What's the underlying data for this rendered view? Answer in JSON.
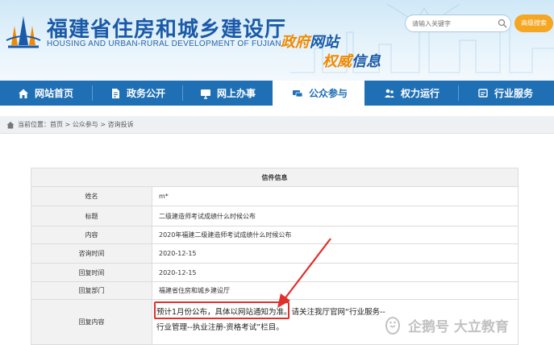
{
  "header": {
    "title_cn": "福建省住房和城乡建设厅",
    "title_en": "HOUSING AND URBAN-RURAL DEVELOPMENT OF FUJIAN",
    "slogan1_a": "政府",
    "slogan1_b": "网站",
    "slogan2_a": "权威",
    "slogan2_b": "信息",
    "search_placeholder": "请输入关键字",
    "adv_search_label": "高级搜索"
  },
  "nav": {
    "items": [
      {
        "label": "网站首页",
        "icon": "home-icon"
      },
      {
        "label": "政务公开",
        "icon": "document-icon"
      },
      {
        "label": "网上办事",
        "icon": "monitor-icon"
      },
      {
        "label": "公众参与",
        "icon": "chat-icon"
      },
      {
        "label": "权力运行",
        "icon": "people-icon"
      },
      {
        "label": "行业服务",
        "icon": "handshake-icon"
      }
    ],
    "active_index": 3
  },
  "breadcrumb": "当前位置：首页 > 公众参与 > 咨询投诉",
  "letter": {
    "header": "信件信息",
    "rows": [
      {
        "label": "姓名",
        "value": "m*"
      },
      {
        "label": "标题",
        "value": "二级建造师考试成绩什么时候公布"
      },
      {
        "label": "内容",
        "value": "2020年福建二级建造师考试成绩什么时候公布"
      },
      {
        "label": "咨询时间",
        "value": "2020-12-15"
      },
      {
        "label": "回复时间",
        "value": "2020-12-15"
      },
      {
        "label": "回复部门",
        "value": "福建省住房和城乡建设厅"
      },
      {
        "label": "回复内容",
        "value": ""
      }
    ],
    "reply_highlight": "预计1月份公布，具体以网站通知为准",
    "reply_rest": "。请关注我厅官网“行业服务--行业管理--执业注册-资格考试”栏目。"
  },
  "watermark": "企鹅号 大立教育",
  "colors": {
    "nav_bg": "#1f6fb5",
    "accent": "#f5a623",
    "highlight": "#e0302a"
  }
}
